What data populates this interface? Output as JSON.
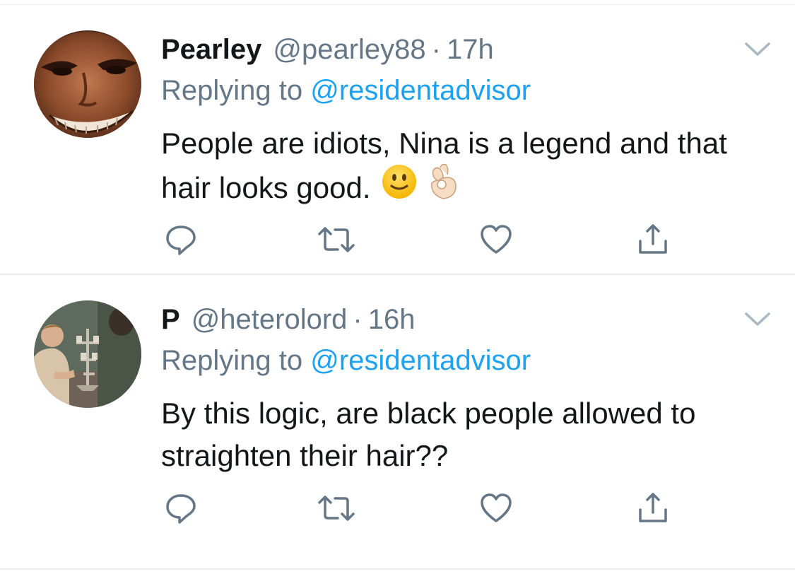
{
  "tweets": [
    {
      "name": "Pearley",
      "handle": "@pearley88",
      "separator": "·",
      "time": "17h",
      "replying_prefix": "Replying to",
      "replying_to": "@residentadvisor",
      "text": "People are idiots, Nina is a legend and that hair looks good.",
      "emojis": [
        "slightly-smiling-face-icon",
        "ok-hand-icon"
      ],
      "avatar": "pearley-avatar"
    },
    {
      "name": "P",
      "handle": "@heterolord",
      "separator": "·",
      "time": "16h",
      "replying_prefix": "Replying to",
      "replying_to": "@residentadvisor",
      "text": "By this logic, are black people allowed to straighten their hair??",
      "avatar": "heterolord-avatar"
    }
  ],
  "action_icons": [
    "reply-icon",
    "retweet-icon",
    "like-icon",
    "share-icon"
  ],
  "colors": {
    "text_primary": "#14171a",
    "text_secondary": "#657786",
    "link": "#1da1f2",
    "divider": "#e6ecf0",
    "icon": "#657786"
  }
}
